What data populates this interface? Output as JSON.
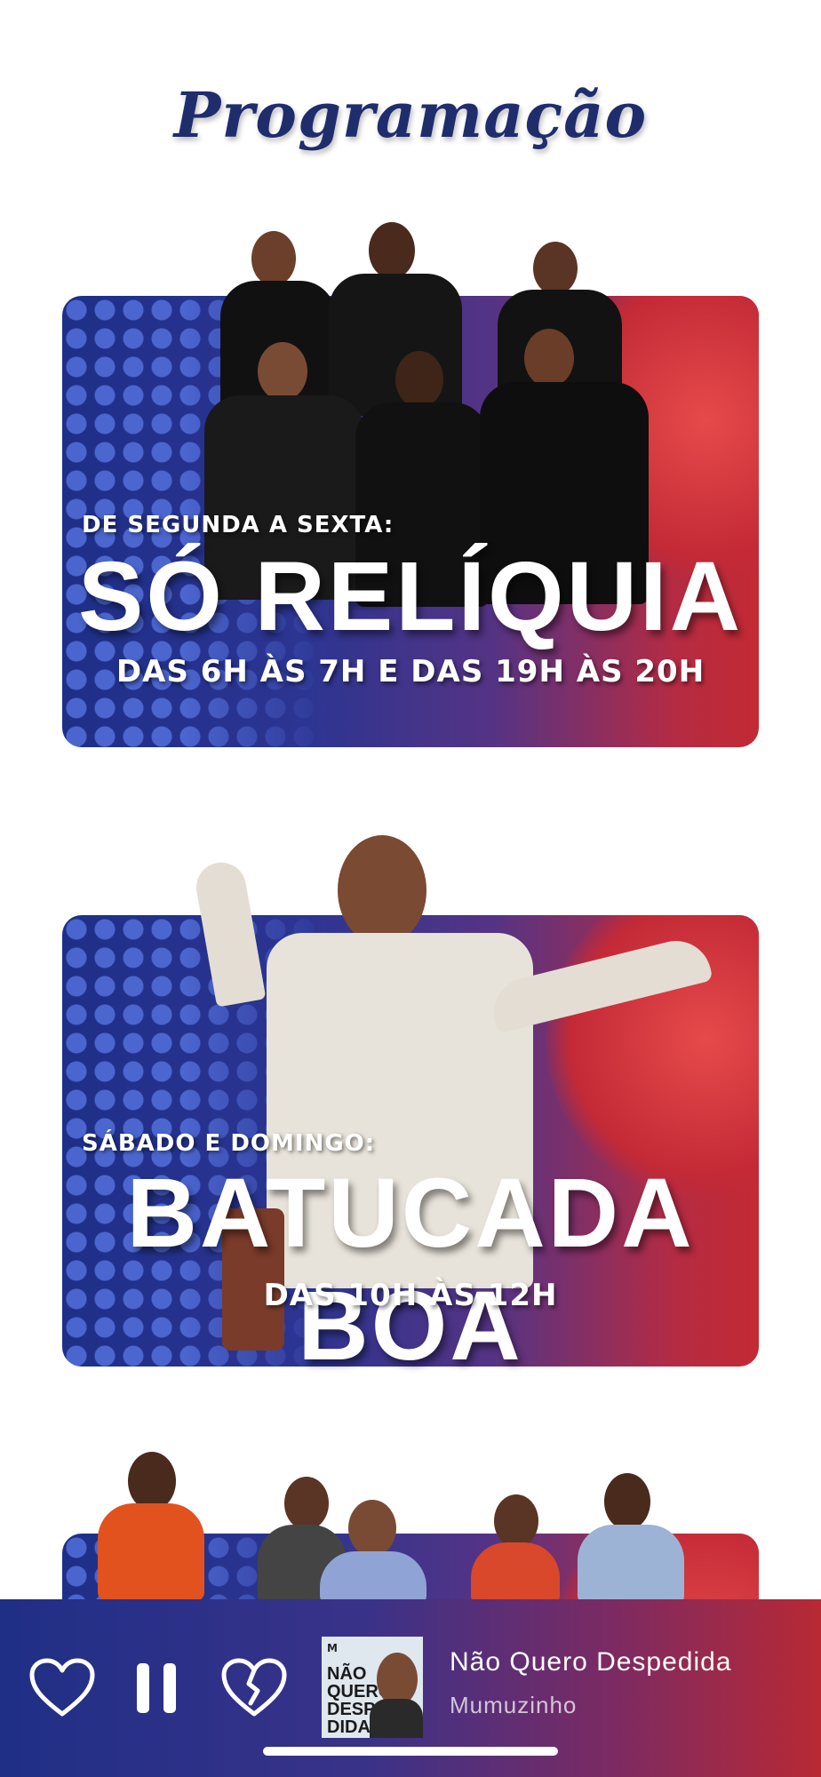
{
  "page": {
    "title": "Programação"
  },
  "programs": [
    {
      "days": "DE SEGUNDA A SEXTA:",
      "name": "SÓ RELÍQUIA",
      "time": "DAS 6H ÀS 7H E DAS 19H ÀS 20H"
    },
    {
      "days": "SÁBADO E DOMINGO:",
      "name": "BATUCADA BOA",
      "time": "DAS 10H ÀS 12H"
    }
  ],
  "player": {
    "track_title": "Não Quero Despedida",
    "artist": "Mumuzinho",
    "album_art_text": "NÃO QUERO DESPE DIDA",
    "icons": [
      "heart-icon",
      "pause-icon",
      "broken-heart-icon"
    ]
  },
  "colors": {
    "title": "#1f2d6d",
    "banner_left": "#1e2f88",
    "banner_right": "#c32a33",
    "player_left": "#1f2f86",
    "player_right": "#b82934"
  }
}
